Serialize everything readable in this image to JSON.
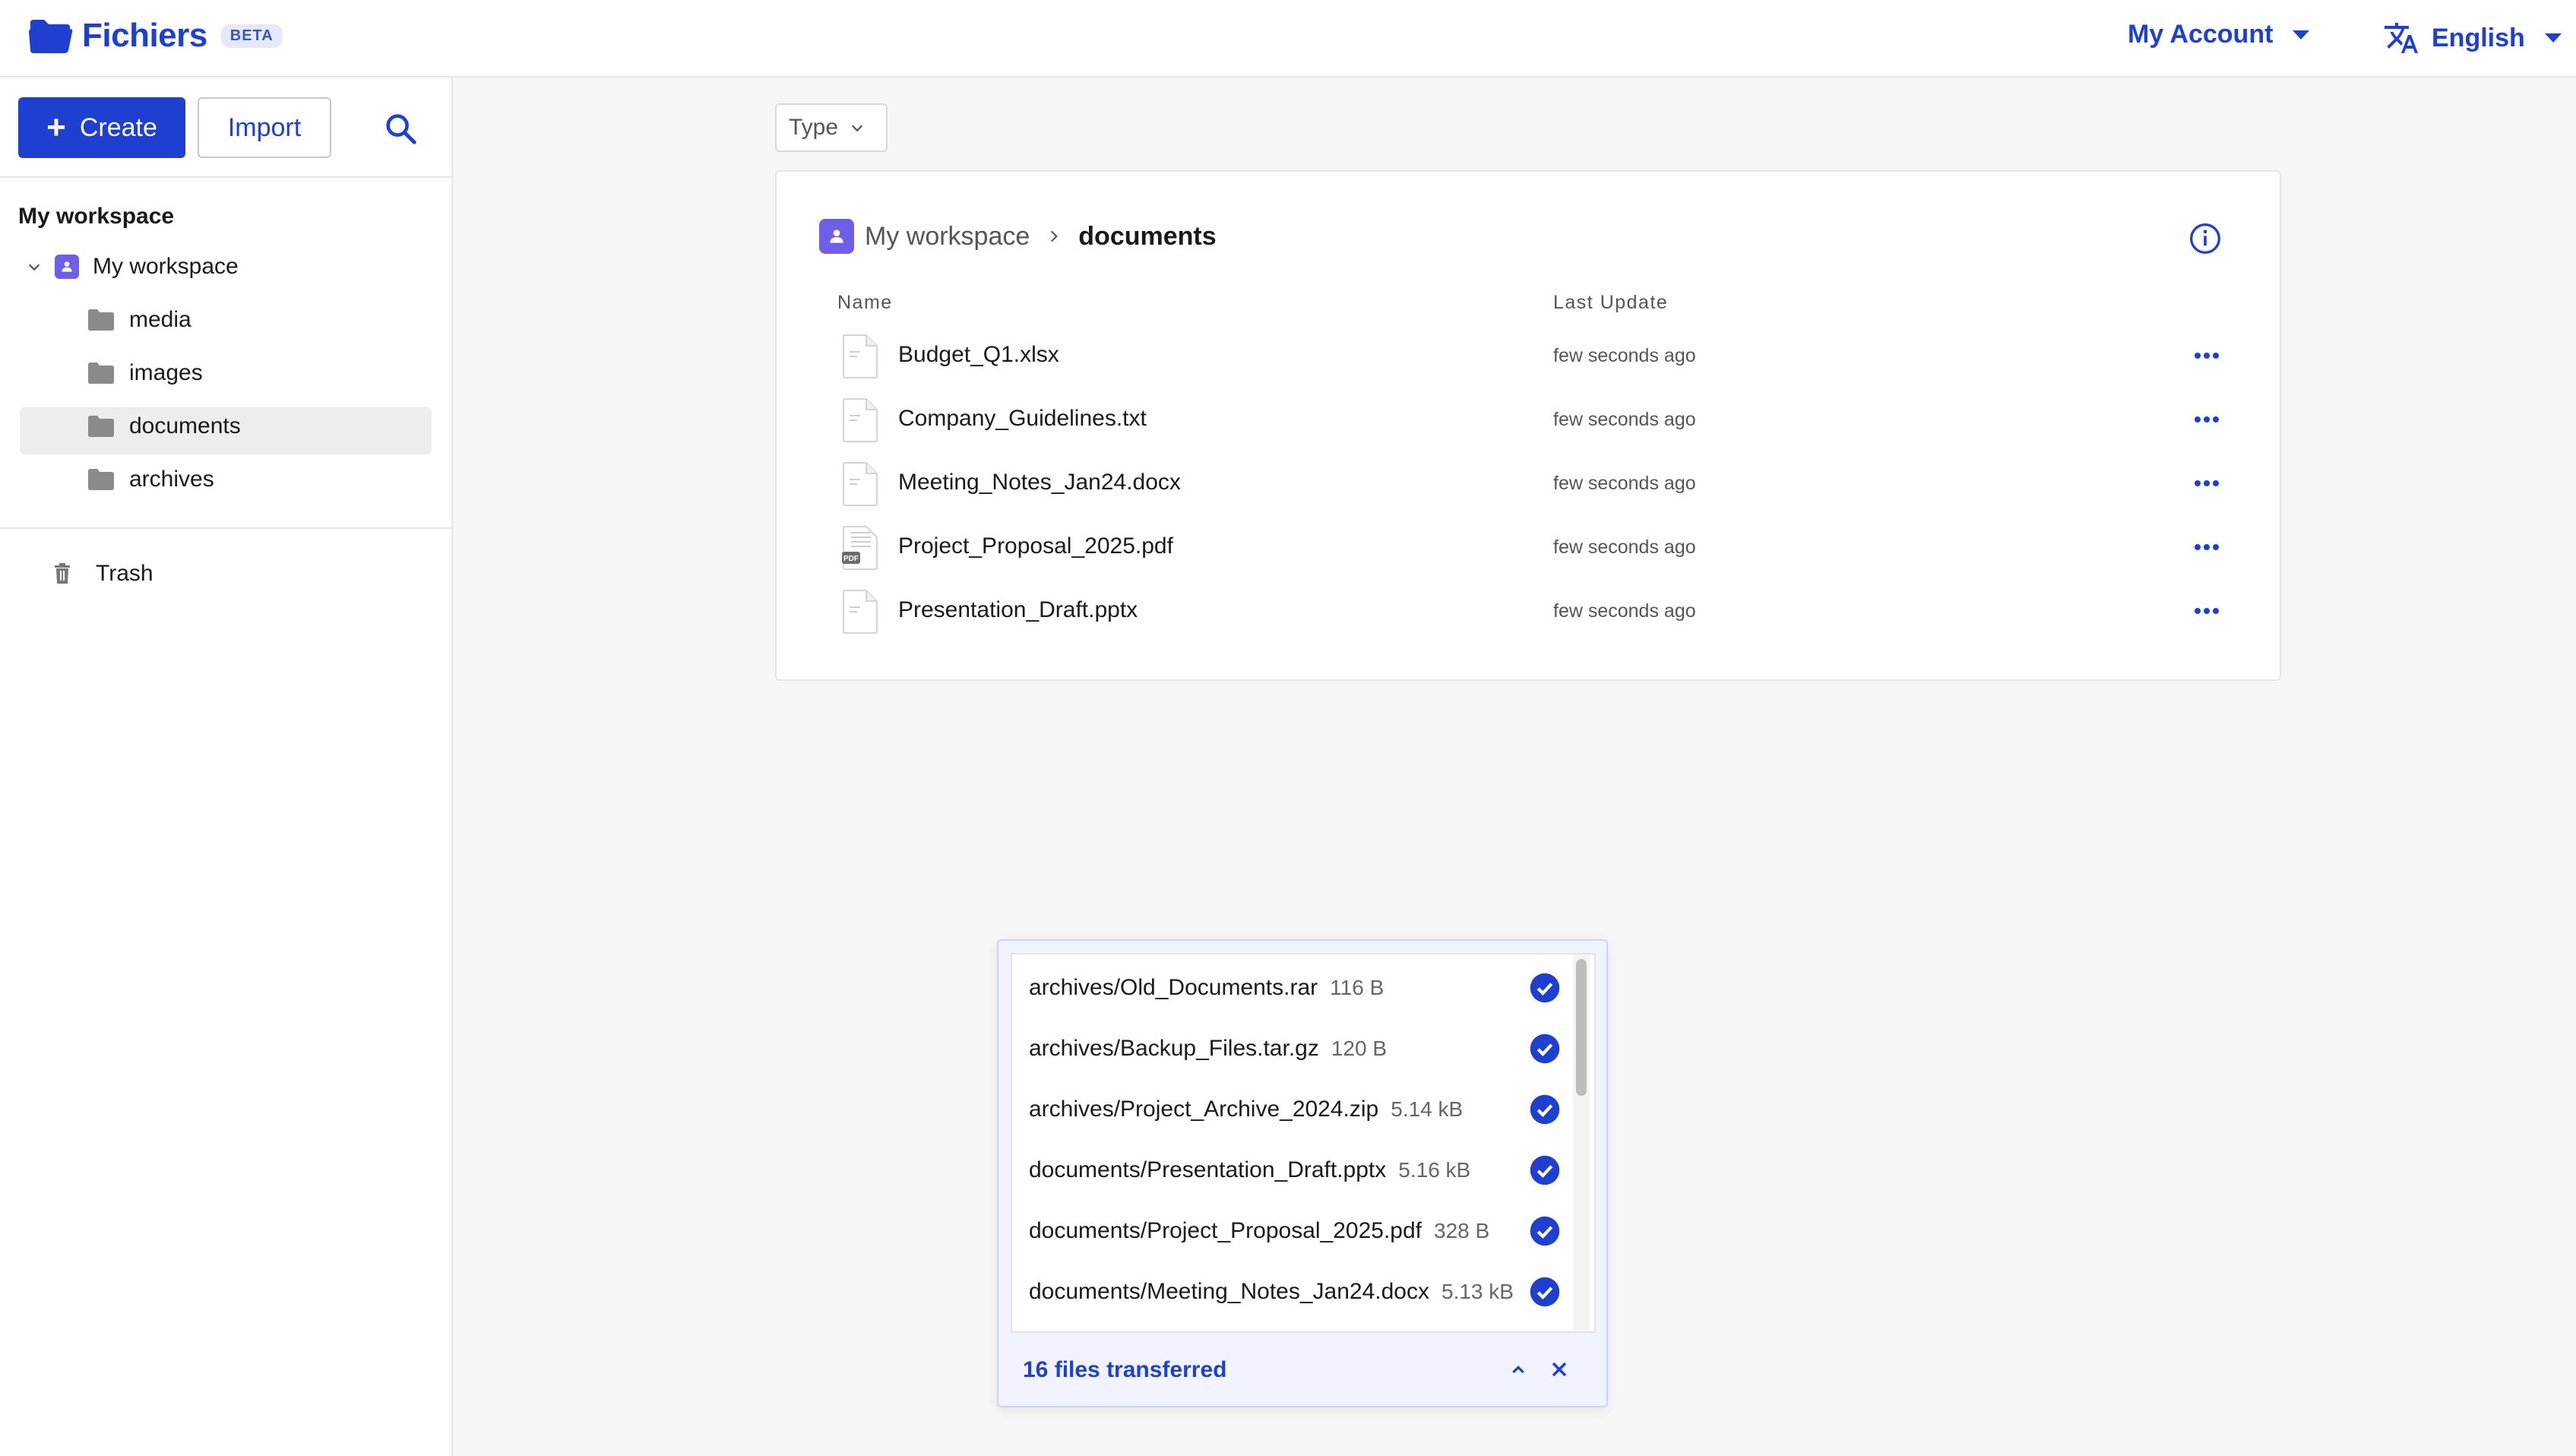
{
  "app": {
    "name": "Fichiers",
    "badge": "BETA",
    "account_label": "My Account",
    "language_label": "English",
    "colors": {
      "primary": "#1f3fd0",
      "workspace": "#6e5ee8",
      "selected_bg": "#ededed"
    }
  },
  "sidebar": {
    "create_label": "Create",
    "import_label": "Import",
    "section_title": "My workspace",
    "root_label": "My workspace",
    "folders": [
      {
        "label": "media"
      },
      {
        "label": "images"
      },
      {
        "label": "documents",
        "selected": true
      },
      {
        "label": "archives"
      }
    ],
    "trash_label": "Trash"
  },
  "main": {
    "filter_type_label": "Type",
    "breadcrumb": {
      "root": "My workspace",
      "current": "documents"
    },
    "columns": {
      "name": "Name",
      "updated": "Last Update"
    },
    "files": [
      {
        "name": "Budget_Q1.xlsx",
        "updated": "few seconds ago",
        "icon": "file-icon"
      },
      {
        "name": "Company_Guidelines.txt",
        "updated": "few seconds ago",
        "icon": "file-icon"
      },
      {
        "name": "Meeting_Notes_Jan24.docx",
        "updated": "few seconds ago",
        "icon": "file-icon"
      },
      {
        "name": "Project_Proposal_2025.pdf",
        "updated": "few seconds ago",
        "icon": "pdf-icon"
      },
      {
        "name": "Presentation_Draft.pptx",
        "updated": "few seconds ago",
        "icon": "file-icon"
      }
    ]
  },
  "upload": {
    "items": [
      {
        "path": "archives/Old_Documents.rar",
        "size": "116 B"
      },
      {
        "path": "archives/Backup_Files.tar.gz",
        "size": "120 B"
      },
      {
        "path": "archives/Project_Archive_2024.zip",
        "size": "5.14 kB"
      },
      {
        "path": "documents/Presentation_Draft.pptx",
        "size": "5.16 kB"
      },
      {
        "path": "documents/Project_Proposal_2025.pdf",
        "size": "328 B"
      },
      {
        "path": "documents/Meeting_Notes_Jan24.docx",
        "size": "5.13 kB"
      }
    ],
    "summary": "16 files transferred"
  }
}
